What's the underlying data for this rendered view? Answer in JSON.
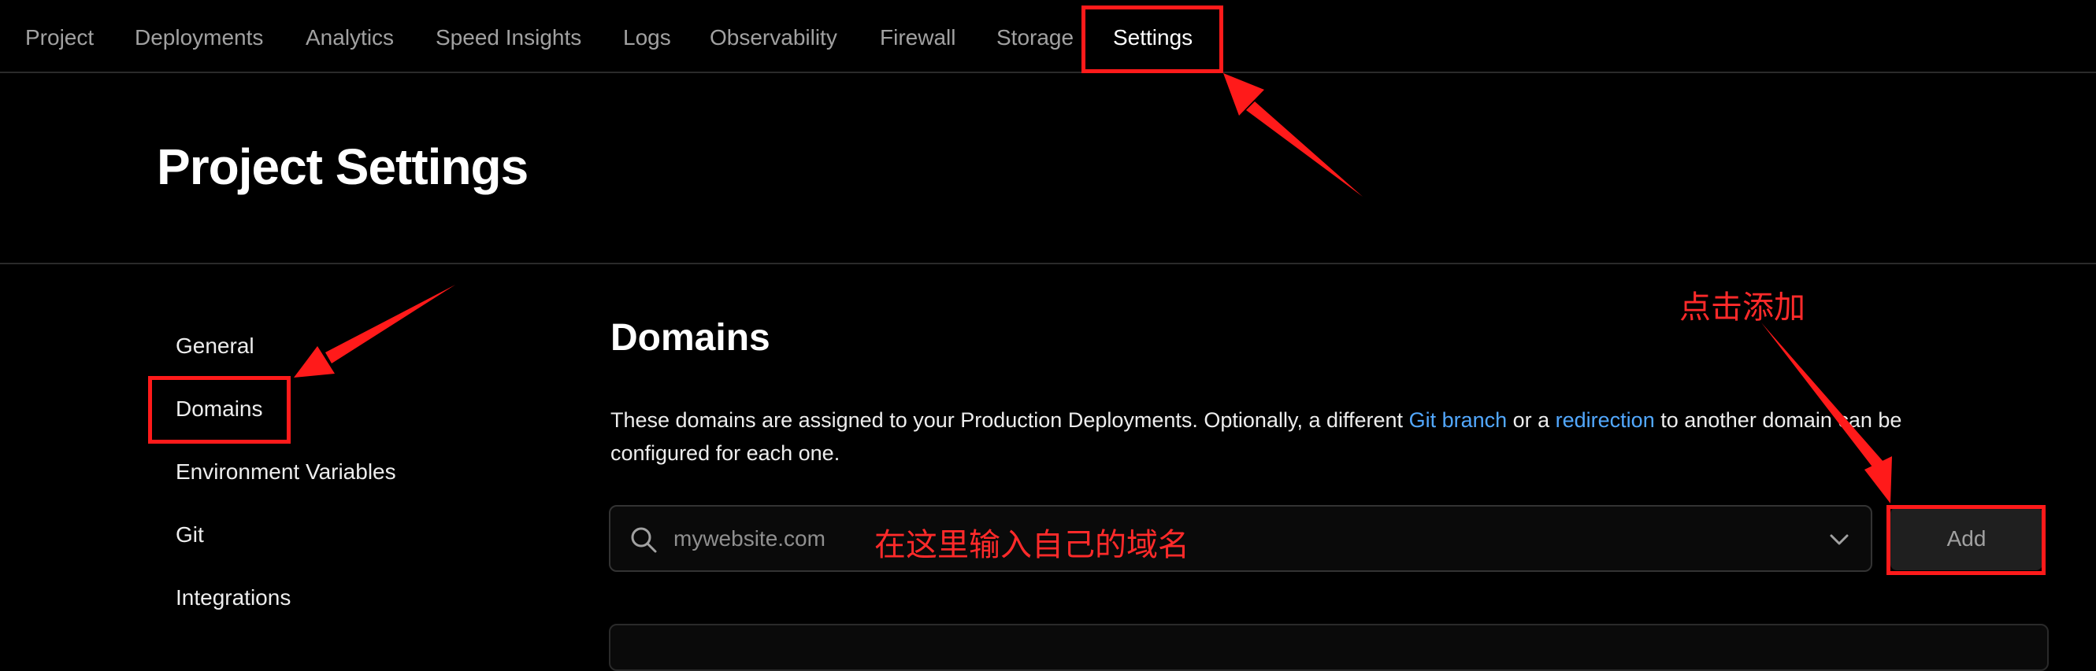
{
  "nav": {
    "tabs": [
      {
        "label": "Project"
      },
      {
        "label": "Deployments"
      },
      {
        "label": "Analytics"
      },
      {
        "label": "Speed Insights"
      },
      {
        "label": "Logs"
      },
      {
        "label": "Observability"
      },
      {
        "label": "Firewall"
      },
      {
        "label": "Storage"
      },
      {
        "label": "Settings",
        "active": true
      }
    ]
  },
  "header": {
    "title": "Project Settings"
  },
  "sidebar": {
    "items": [
      {
        "label": "General"
      },
      {
        "label": "Domains",
        "active": true
      },
      {
        "label": "Environment Variables"
      },
      {
        "label": "Git"
      },
      {
        "label": "Integrations"
      }
    ]
  },
  "domains": {
    "title": "Domains",
    "desc_part1": "These domains are assigned to your Production Deployments. Optionally, a different ",
    "desc_link1": "Git branch",
    "desc_part2": " or a ",
    "desc_link2": "redirection",
    "desc_part3": " to another domain can be configured for each one.",
    "input_placeholder": "mywebsite.com",
    "add_label": "Add"
  },
  "annotations": {
    "input_hint": "在这里输入自己的域名",
    "add_hint": "点击添加",
    "color": "#ff1a1a"
  },
  "icons": {
    "search": "search-icon",
    "dropdown": "chevron-down-icon"
  }
}
